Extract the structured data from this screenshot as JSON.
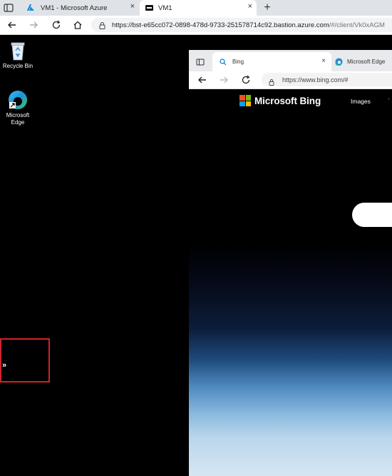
{
  "outer_browser": {
    "tabs": [
      {
        "label": "VM1 - Microsoft Azure",
        "close": "×"
      },
      {
        "label": "VM1",
        "close": "×"
      }
    ],
    "new_tab": "+",
    "address": {
      "host": "https://bst-e65cc072-0898-478d-9733-251578714c92.bastion.azure.com",
      "path": "/#/client/Vk0xAGM"
    }
  },
  "desktop": {
    "icons": [
      {
        "label": "Recycle Bin"
      },
      {
        "label": "Microsoft Edge"
      }
    ],
    "tray_toggle_glyph": "»"
  },
  "inner_browser": {
    "tabs": [
      {
        "label": "Bing",
        "close": "×"
      },
      {
        "label": "Microsoft Edge"
      }
    ],
    "address": "https://www.bing.com/#"
  },
  "bing": {
    "brand": "Microsoft Bing",
    "nav": [
      "Images"
    ],
    "more": "·"
  },
  "colors": {
    "azure_accent": "#0078d4",
    "highlight_box": "#d1232a",
    "ms_red": "#f25022",
    "ms_green": "#7fba00",
    "ms_blue": "#00a4ef",
    "ms_yellow": "#ffb900"
  }
}
